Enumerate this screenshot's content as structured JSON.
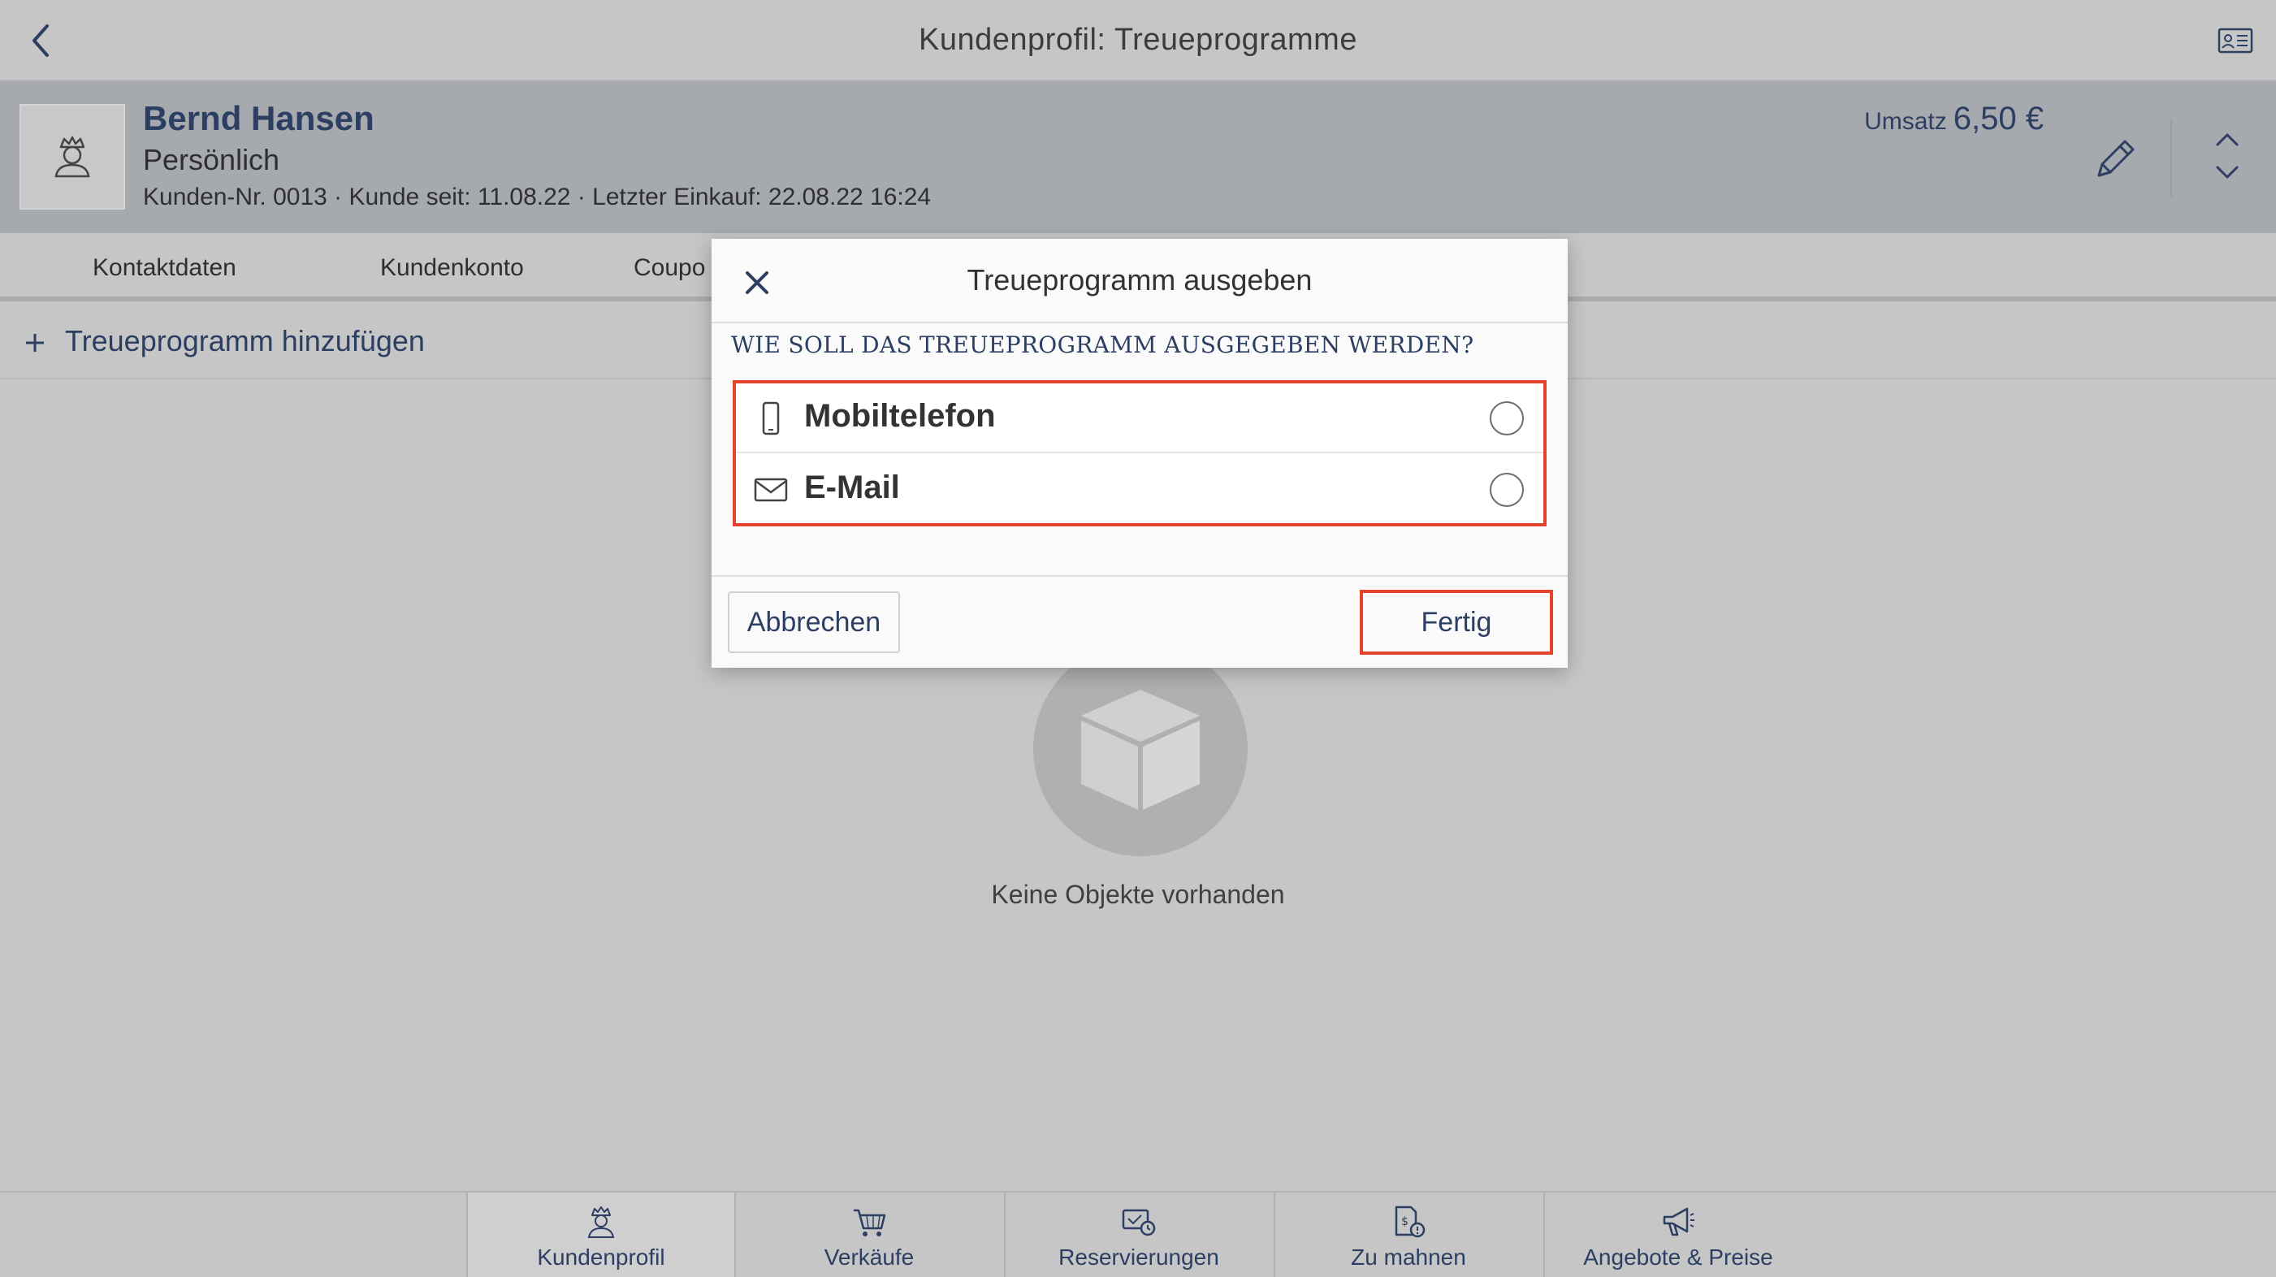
{
  "topbar": {
    "title": "Kundenprofil: Treueprogramme",
    "back_icon": "chevron-left-icon",
    "card_icon": "id-card-icon"
  },
  "customer": {
    "name": "Bernd Hansen",
    "type": "Persönlich",
    "meta": "Kunden-Nr. 0013 · Kunde seit: 11.08.22 · Letzter Einkauf: 22.08.22 16:24",
    "umsatz_label": "Umsatz",
    "umsatz_value": "6,50 €"
  },
  "tabs": [
    {
      "label": "Kontaktdaten"
    },
    {
      "label": "Kundenkonto"
    },
    {
      "label": "Coupo"
    }
  ],
  "addbar": {
    "label": "Treueprogramm hinzufügen"
  },
  "empty_state": {
    "text": "Keine Objekte vorhanden"
  },
  "dialog": {
    "title": "Treueprogramm ausgeben",
    "question": "WIE SOLL DAS TREUEPROGRAMM AUSGEGEBEN WERDEN?",
    "options": [
      {
        "label": "Mobiltelefon",
        "icon": "mobile-phone-icon",
        "selected": false
      },
      {
        "label": "E-Mail",
        "icon": "envelope-icon",
        "selected": false
      }
    ],
    "cancel_label": "Abbrechen",
    "done_label": "Fertig",
    "highlight_color": "#e2442d"
  },
  "bottom_nav": [
    {
      "label": "Kundenprofil",
      "icon": "customer-icon",
      "active": true
    },
    {
      "label": "Verkäufe",
      "icon": "cart-icon",
      "active": false
    },
    {
      "label": "Reservierungen",
      "icon": "reservation-icon",
      "active": false
    },
    {
      "label": "Zu mahnen",
      "icon": "reminder-icon",
      "active": false
    },
    {
      "label": "Angebote & Preise",
      "icon": "megaphone-icon",
      "active": false
    }
  ],
  "colors": {
    "accent": "#2c3e62",
    "background": "#c6c6c6",
    "header": "#a6a9ae"
  }
}
